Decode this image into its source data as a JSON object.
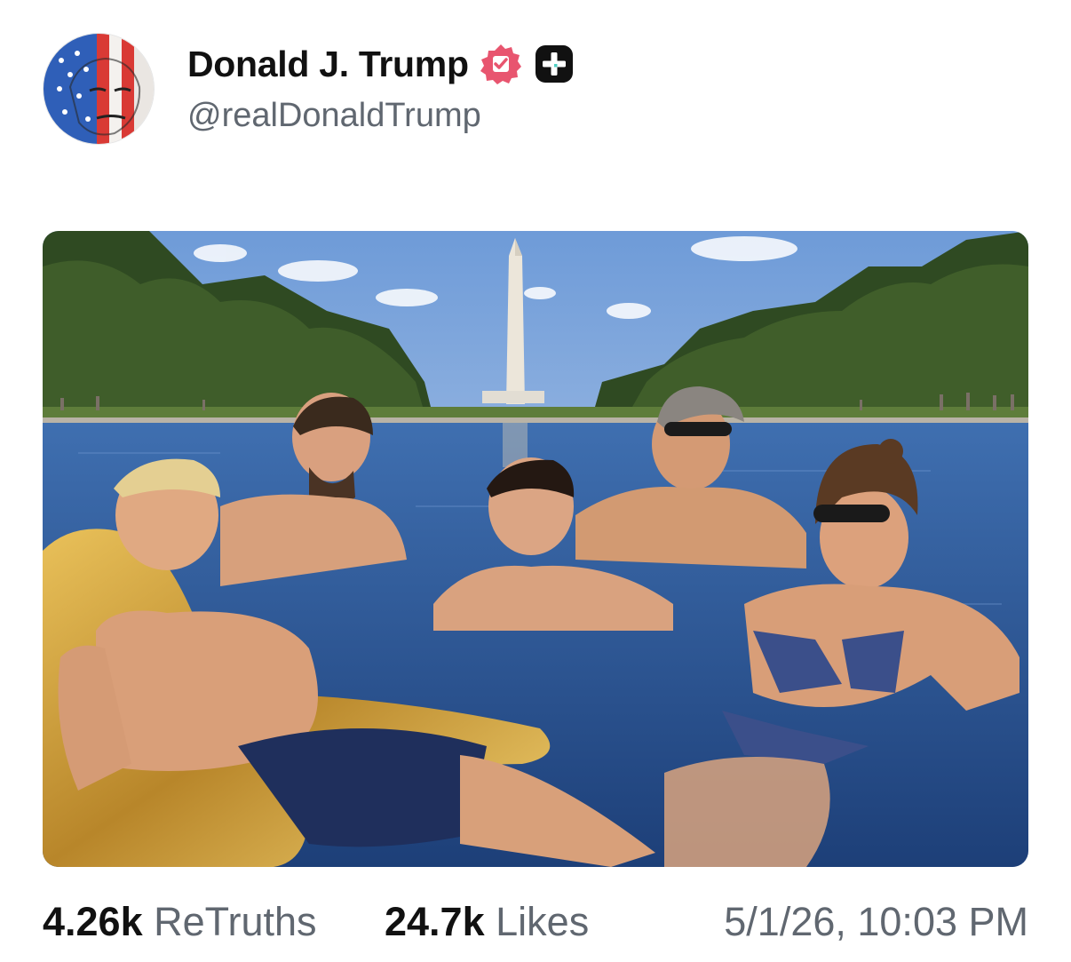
{
  "post": {
    "author": {
      "display_name": "Donald J. Trump",
      "handle": "@realDonaldTrump",
      "verified_icon": "verified-badge-icon",
      "extra_icon": "plus-badge-icon",
      "verified_color": "#e8556f"
    },
    "media": {
      "type": "photo"
    },
    "stats": {
      "retruths_count": "4.26k",
      "retruths_label": "ReTruths",
      "likes_count": "24.7k",
      "likes_label": "Likes"
    },
    "timestamp": "5/1/26, 10:03 PM"
  }
}
